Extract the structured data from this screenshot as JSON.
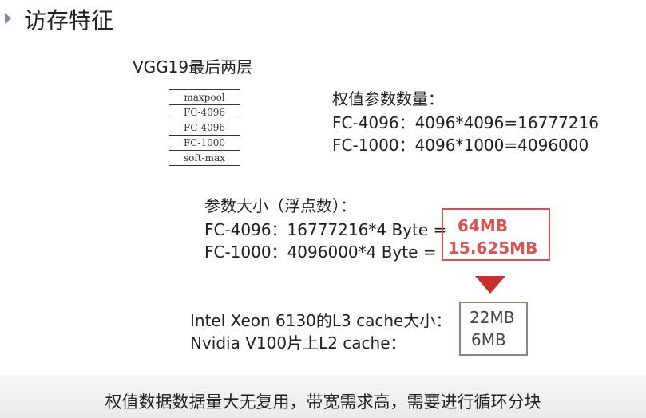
{
  "title": "访存特征",
  "subtitle": "VGG19最后两层",
  "layers": [
    "maxpool",
    "FC-4096",
    "FC-4096",
    "FC-1000",
    "soft-max"
  ],
  "param_count": {
    "heading": "权值参数数量：",
    "line1": "FC-4096：4096*4096=16777216",
    "line2": "FC-1000：4096*1000=4096000"
  },
  "param_size": {
    "heading": "参数大小（浮点数）：",
    "line1_prefix": "FC-4096：16777216*4 Byte =",
    "line1_value": "64MB",
    "line2_prefix": "FC-1000：4096000*4 Byte =",
    "line2_value": "15.625MB"
  },
  "cache": {
    "line1_label": "Intel Xeon 6130的L3 cache大小：",
    "line1_value": "22MB",
    "line2_label": "Nvidia V100片上L2 cache：",
    "line2_value": "6MB"
  },
  "footer_caption": "权值数据数据量大无复用，带宽需求高，需要进行循环分块",
  "colors": {
    "highlight_red": "#d9534f",
    "arrow_red": "#c9302c",
    "box_gray": "#9b8074"
  }
}
